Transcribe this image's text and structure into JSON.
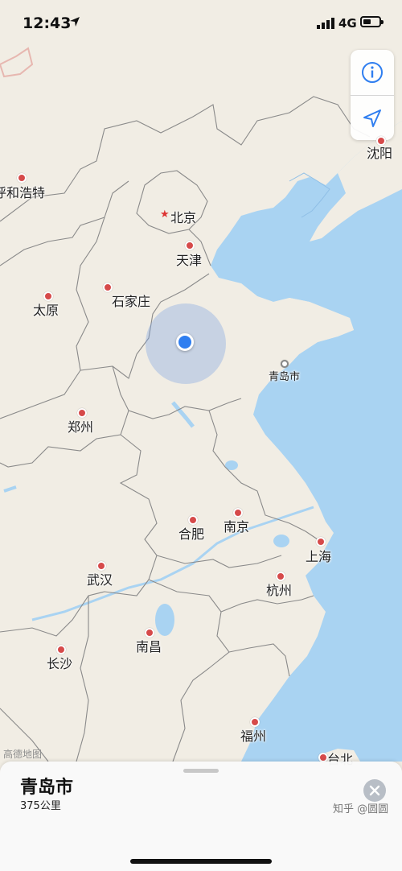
{
  "status_bar": {
    "time": "12:43",
    "network": "4G"
  },
  "map_controls": {
    "info_icon": "info-icon",
    "track_icon": "location-arrow-icon"
  },
  "cities": [
    {
      "id": "shenyang",
      "label": "沈阳"
    },
    {
      "id": "hohhot",
      "label": "呼和浩特"
    },
    {
      "id": "beijing",
      "label": "北京"
    },
    {
      "id": "tianjin",
      "label": "天津"
    },
    {
      "id": "shijiazhuang",
      "label": "石家庄"
    },
    {
      "id": "taiyuan",
      "label": "太原"
    },
    {
      "id": "qingdao",
      "label": "青岛市"
    },
    {
      "id": "zhengzhou",
      "label": "郑州"
    },
    {
      "id": "hefei",
      "label": "合肥"
    },
    {
      "id": "nanjing",
      "label": "南京"
    },
    {
      "id": "shanghai",
      "label": "上海"
    },
    {
      "id": "wuhan",
      "label": "武汉"
    },
    {
      "id": "hangzhou",
      "label": "杭州"
    },
    {
      "id": "nanchang",
      "label": "南昌"
    },
    {
      "id": "changsha",
      "label": "长沙"
    },
    {
      "id": "fuzhou",
      "label": "福州"
    },
    {
      "id": "taipei",
      "label": "台北"
    }
  ],
  "map_attribution": "高德地图",
  "place_sheet": {
    "title": "青岛市",
    "distance": "375公里",
    "watermark": "知乎 @圆圆"
  },
  "colors": {
    "land": "#f1ede4",
    "water": "#a9d3f2",
    "border": "#8a8a8a",
    "user_dot": "#2f7ef0"
  }
}
